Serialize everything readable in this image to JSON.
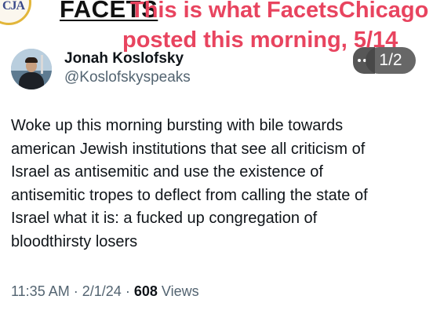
{
  "header": {
    "logo_text": "CJA",
    "brand_title": "FACETS"
  },
  "caption": {
    "line1": "This is what FacetsChicago",
    "line2": "posted this morning, 5/14"
  },
  "tweet": {
    "display_name": "Jonah Koslofsky",
    "handle": "@Koslofskyspeaks",
    "body": "Woke up this morning bursting with bile towards\namerican Jewish institutions that see all criticism of\nIsrael as antisemitic and use the existence of\nantisemitic tropes to deflect from calling the state of\nIsrael what it is: a fucked up congregation of\nbloodthirsty losers",
    "time": "11:35 AM",
    "separator": "·",
    "date": "2/1/24",
    "views_count": "608",
    "views_label": "Views"
  },
  "pager": {
    "label": "1/2"
  },
  "icons": {
    "more": "more-options-icon",
    "logo": "cja-logo-icon"
  },
  "colors": {
    "caption": "#e8445f",
    "secondary_text": "#536471",
    "primary_text": "#0f1419",
    "logo_ring": "#e2b63a"
  }
}
